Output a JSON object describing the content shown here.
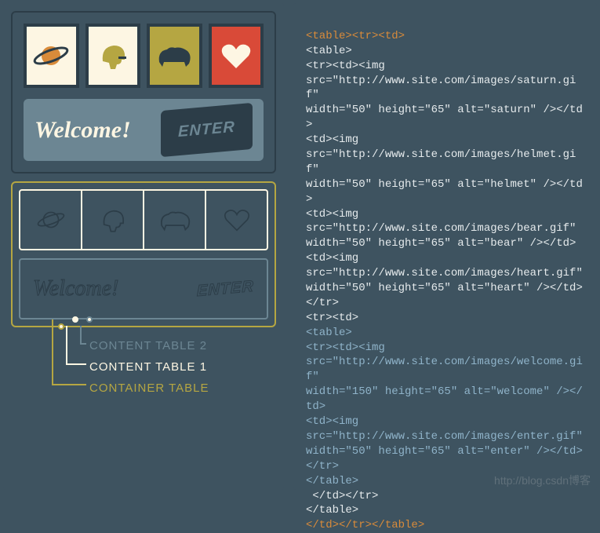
{
  "mockup": {
    "welcome": "Welcome!",
    "enter": "ENTER"
  },
  "labels": {
    "content2": "CONTENT TABLE 2",
    "content1": "CONTENT TABLE 1",
    "container": "CONTAINER TABLE"
  },
  "code": {
    "l01": "<table><tr><td>",
    "l02": "<table>",
    "l03": "<tr><td><img",
    "l04": "src=\"http://www.site.com/images/saturn.gif\"",
    "l05": "width=\"50\" height=\"65\" alt=\"saturn\" /></td>",
    "l06": "<td><img",
    "l07": "src=\"http://www.site.com/images/helmet.gif\"",
    "l08": "width=\"50\" height=\"65\" alt=\"helmet\" /></td>",
    "l09": "<td><img",
    "l10": "src=\"http://www.site.com/images/bear.gif\"",
    "l11": "width=\"50\" height=\"65\" alt=\"bear\" /></td>",
    "l12": "<td><img",
    "l13": "src=\"http://www.site.com/images/heart.gif\"",
    "l14": "width=\"50\" height=\"65\" alt=\"heart\" /></td>",
    "l15": "</tr>",
    "l16": "<tr><td>",
    "l17": "<table>",
    "l18": "<tr><td><img",
    "l19": "src=\"http://www.site.com/images/welcome.gif\"",
    "l20": "width=\"150\" height=\"65\" alt=\"welcome\" /></td>",
    "l21": "<td><img",
    "l22": "src=\"http://www.site.com/images/enter.gif\"",
    "l23": "width=\"50\" height=\"65\" alt=\"enter\" /></td>",
    "l24": "</tr>",
    "l25": "</table>",
    "l26": " </td></tr>",
    "l27": "</table>",
    "l28": "</td></tr></table>"
  },
  "watermark": "http://blog.csdn博客"
}
